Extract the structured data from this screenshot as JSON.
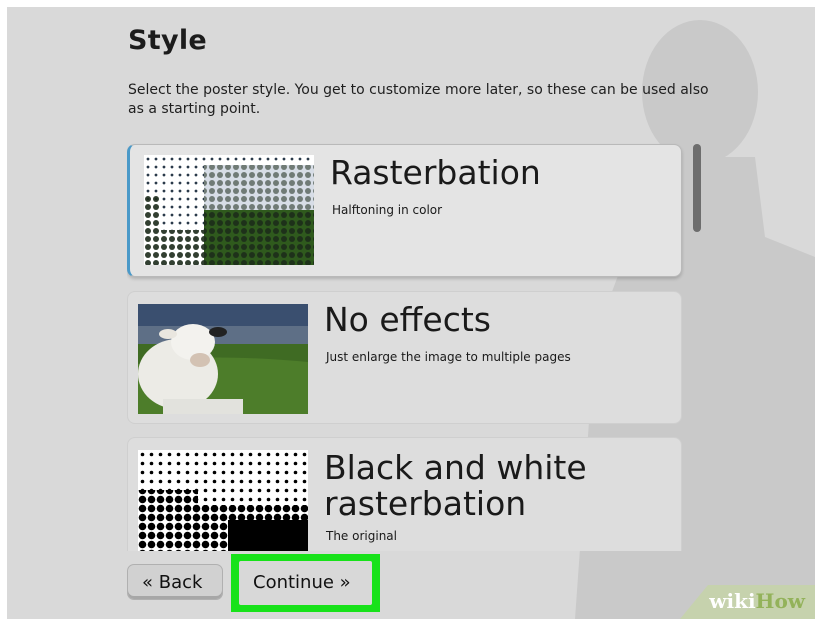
{
  "style_section": {
    "heading": "Style",
    "description": "Select the poster style. You get to customize more later, so these can be used also as a starting point."
  },
  "styles": [
    {
      "title": "Rasterbation",
      "subtitle": "Halftoning in color",
      "selected": true,
      "thumbnail": "color-halftone-cow"
    },
    {
      "title": "No effects",
      "subtitle": "Just enlarge the image to multiple pages",
      "selected": false,
      "thumbnail": "cow-photo"
    },
    {
      "title": "Black and white rasterbation",
      "subtitle": "The original",
      "selected": false,
      "thumbnail": "bw-halftone-cow"
    }
  ],
  "nav": {
    "back_label": "« Back",
    "continue_label": "Continue »"
  },
  "watermark": {
    "part1": "wiki",
    "part2": "How"
  },
  "colors": {
    "selection_accent": "#4a99c8",
    "highlight": "#18e21a",
    "background": "#d9d9d9"
  }
}
